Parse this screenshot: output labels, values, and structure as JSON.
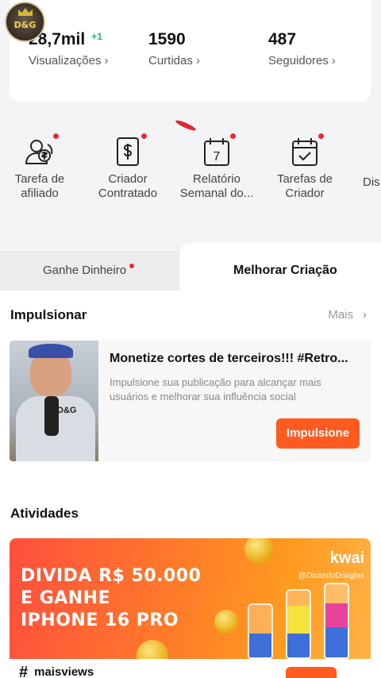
{
  "stats": {
    "views": {
      "value": "28,7mil",
      "delta": "+1",
      "label": "Visualizações"
    },
    "likes": {
      "value": "1590",
      "label": "Curtidas"
    },
    "followers": {
      "value": "487",
      "label": "Seguidores"
    }
  },
  "logo_text": "D&G",
  "tools": [
    {
      "label": "Tarefa de\nafiliado",
      "icon": "affiliate-icon"
    },
    {
      "label": "Criador\nContratado",
      "icon": "dollar-document-icon"
    },
    {
      "label": "Relatório\nSemanal do...",
      "icon": "calendar-7-icon",
      "day": "7"
    },
    {
      "label": "Tarefas de\nCriador",
      "icon": "calendar-check-icon"
    },
    {
      "label": "Dis",
      "icon": "partial-icon"
    }
  ],
  "tabs": {
    "earn": "Ganhe Dinheiro",
    "improve": "Melhorar Criação"
  },
  "boost": {
    "title": "Impulsionar",
    "more": "Mais",
    "card_title": "Monetize cortes de terceiros!!! #Retro...",
    "card_desc": "Impulsione sua publicação para alcançar mais usuários e melhorar sua influência social",
    "button": "Impulsione"
  },
  "activities": {
    "title": "Atividades",
    "banner_text": "DIVIDA R$ 50.000\nE GANHE\nIPHONE 16 PRO",
    "brand": "kwai",
    "handle": "@DicasdoDouglas",
    "hashtag": "maisviews"
  },
  "colors": {
    "accent": "#ff5a1f",
    "badge": "#f0263b",
    "positive": "#1fb56a"
  }
}
